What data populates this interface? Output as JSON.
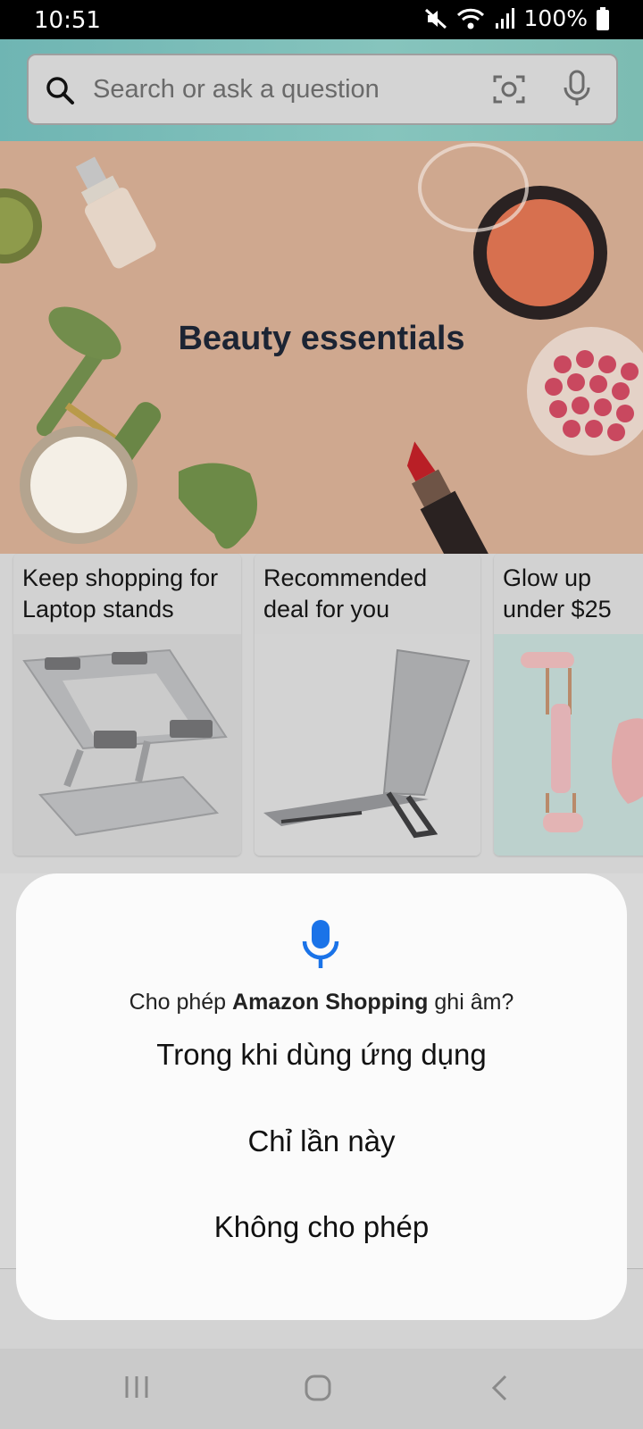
{
  "status_bar": {
    "time": "10:51",
    "battery": "100%",
    "icons": [
      "mute-icon",
      "wifi-icon",
      "signal-icon",
      "battery-icon"
    ]
  },
  "search": {
    "placeholder": "Search or ask a question",
    "icons": [
      "search-icon",
      "camera-icon",
      "mic-icon"
    ]
  },
  "hero": {
    "title": "Beauty essentials"
  },
  "cards": [
    {
      "title_line1": "Keep shopping for",
      "title_line2": "Laptop stands"
    },
    {
      "title_line1": "Recommended",
      "title_line2": "deal for you"
    },
    {
      "title_line1": "Glow up",
      "title_line2": "under $25"
    }
  ],
  "dialog": {
    "message_prefix": "Cho phép ",
    "app_name": "Amazon Shopping",
    "message_suffix": " ghi âm?",
    "options": [
      "Trong khi dùng ứng dụng",
      "Chỉ lần này",
      "Không cho phép"
    ],
    "accent_color": "#1a73e8"
  },
  "system_nav": {
    "buttons": [
      "recents-button",
      "home-button",
      "back-button"
    ]
  }
}
